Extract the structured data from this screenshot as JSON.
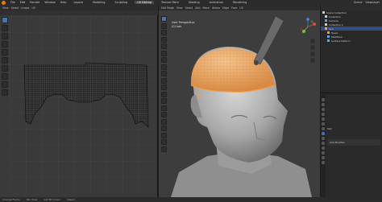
{
  "menu": {
    "items": [
      "File",
      "Edit",
      "Render",
      "Window",
      "Help"
    ],
    "workspaces": [
      "Layout",
      "Modeling",
      "Sculpting",
      "UV Editing",
      "Texture Paint",
      "Shading",
      "Animation",
      "Rendering"
    ],
    "active_workspace_index": 3,
    "scene": "Scene",
    "view_layer": "ViewLayer"
  },
  "uv_editor": {
    "header_items": [
      "View",
      "Select",
      "Image",
      "UV"
    ]
  },
  "viewport": {
    "header_items": [
      "Edit Mode",
      "View",
      "Select",
      "Add",
      "Mesh",
      "Vertex",
      "Edge",
      "Face",
      "UV"
    ],
    "info_line1": "User Perspective",
    "info_line2": "(0) hair",
    "accent_color": "#e8a25a"
  },
  "outliner": {
    "title": "Scene Collection",
    "rows": [
      {
        "label": "Scene Collection",
        "color": "#cfcfcf",
        "selected": false
      },
      {
        "label": "Collection",
        "color": "#cfcfcf",
        "selected": false
      },
      {
        "label": "Camera",
        "color": "#5fa3d6",
        "selected": false
      },
      {
        "label": "Collection 2",
        "color": "#cfcfcf",
        "selected": false
      },
      {
        "label": "hair",
        "color": "#e8a25a",
        "selected": true
      },
      {
        "label": "Head",
        "color": "#e8a25a",
        "selected": false
      },
      {
        "label": "Modifiers",
        "color": "#6aa3e0",
        "selected": false
      },
      {
        "label": "Surface Deform",
        "color": "#6aa3e0",
        "selected": false
      }
    ]
  },
  "properties": {
    "object_label": "hair",
    "modifier_label": "Add Modifier"
  },
  "statusbar": {
    "items": [
      "Change Frame",
      "Pan View",
      "Set 3D Cursor",
      "Object"
    ]
  }
}
